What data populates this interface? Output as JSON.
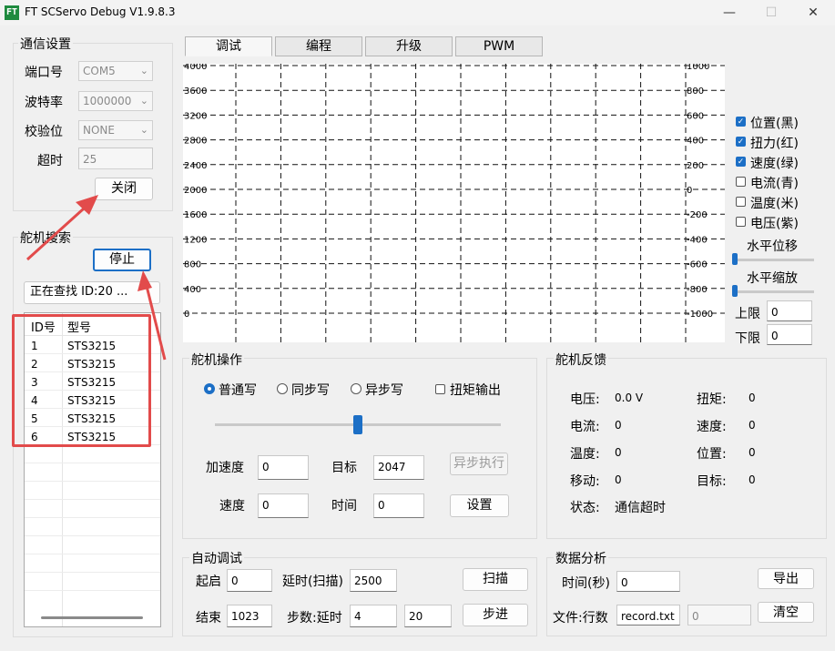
{
  "window": {
    "title": "FT SCServo Debug V1.9.8.3",
    "logo_text": "FT",
    "minimize_glyph": "—",
    "maximize_glyph": "☐",
    "close_glyph": "✕"
  },
  "comm": {
    "group_label": "通信设置",
    "port_label": "端口号",
    "port_value": "COM5",
    "baud_label": "波特率",
    "baud_value": "1000000",
    "parity_label": "校验位",
    "parity_value": "NONE",
    "timeout_label": "超时",
    "timeout_value": "25",
    "close_button": "关闭"
  },
  "search": {
    "group_label": "舵机搜索",
    "stop_button": "停止",
    "status_button": "正在查找 ID:20 ...",
    "col_id": "ID号",
    "col_model": "型号",
    "rows": [
      {
        "id": "1",
        "model": "STS3215"
      },
      {
        "id": "2",
        "model": "STS3215"
      },
      {
        "id": "3",
        "model": "STS3215"
      },
      {
        "id": "4",
        "model": "STS3215"
      },
      {
        "id": "5",
        "model": "STS3215"
      },
      {
        "id": "6",
        "model": "STS3215"
      }
    ]
  },
  "tabs": [
    "调试",
    "编程",
    "升级",
    "PWM"
  ],
  "chart_data": {
    "type": "line",
    "left_ticks": [
      "4000",
      "3600",
      "3200",
      "2800",
      "2400",
      "2000",
      "1600",
      "1200",
      "800",
      "400",
      "0"
    ],
    "right_ticks": [
      "1000",
      "800",
      "600",
      "400",
      "200",
      "0",
      "-200",
      "-400",
      "-600",
      "-800",
      "-1000"
    ],
    "ylim_left": [
      0,
      4000
    ],
    "ylim_right": [
      -1000,
      1000
    ],
    "grid": true,
    "series": []
  },
  "legend": [
    {
      "label": "位置(黑)",
      "checked": true
    },
    {
      "label": "扭力(红)",
      "checked": true
    },
    {
      "label": "速度(绿)",
      "checked": true
    },
    {
      "label": "电流(青)",
      "checked": false
    },
    {
      "label": "温度(米)",
      "checked": false
    },
    {
      "label": "电压(紫)",
      "checked": false
    }
  ],
  "hshift_label": "水平位移",
  "hzoom_label": "水平缩放",
  "upper_label": "上限",
  "upper_value": "0",
  "lower_label": "下限",
  "lower_value": "0",
  "servo_op": {
    "group_label": "舵机操作",
    "radio_normal": "普通写",
    "radio_sync": "同步写",
    "radio_async": "异步写",
    "torque_label": "扭矩输出",
    "accel_label": "加速度",
    "accel_value": "0",
    "target_label": "目标",
    "target_value": "2047",
    "async_exec_button": "异步执行",
    "speed_label": "速度",
    "speed_value": "0",
    "time_label": "时间",
    "time_value": "0",
    "set_button": "设置",
    "slider_fraction": 0.5
  },
  "feedback": {
    "group_label": "舵机反馈",
    "voltage_label": "电压:",
    "voltage_value": "0.0 V",
    "torque_label": "扭矩:",
    "torque_value": "0",
    "current_label": "电流:",
    "current_value": "0",
    "speed_label": "速度:",
    "speed_value": "0",
    "temp_label": "温度:",
    "temp_value": "0",
    "position_label": "位置:",
    "position_value": "0",
    "move_label": "移动:",
    "move_value": "0",
    "target_label": "目标:",
    "target_value": "0",
    "status_label": "状态:",
    "status_value": "通信超时"
  },
  "auto": {
    "group_label": "自动调试",
    "start_label": "起启",
    "start_value": "0",
    "delay_scan_label": "延时(扫描)",
    "delay_scan_value": "2500",
    "scan_button": "扫描",
    "end_label": "结束",
    "end_value": "1023",
    "step_delay_label": "步数:延时",
    "step_value": "4",
    "delay_value": "20",
    "step_button": "步进"
  },
  "analysis": {
    "group_label": "数据分析",
    "time_label": "时间(秒)",
    "time_value": "0",
    "export_button": "导出",
    "file_label": "文件:行数",
    "file_value": "record.txt",
    "rows_value": "0",
    "clear_button": "清空"
  },
  "colors": {
    "accent": "#1c6fc6",
    "annotation_red": "#e24b4b"
  }
}
